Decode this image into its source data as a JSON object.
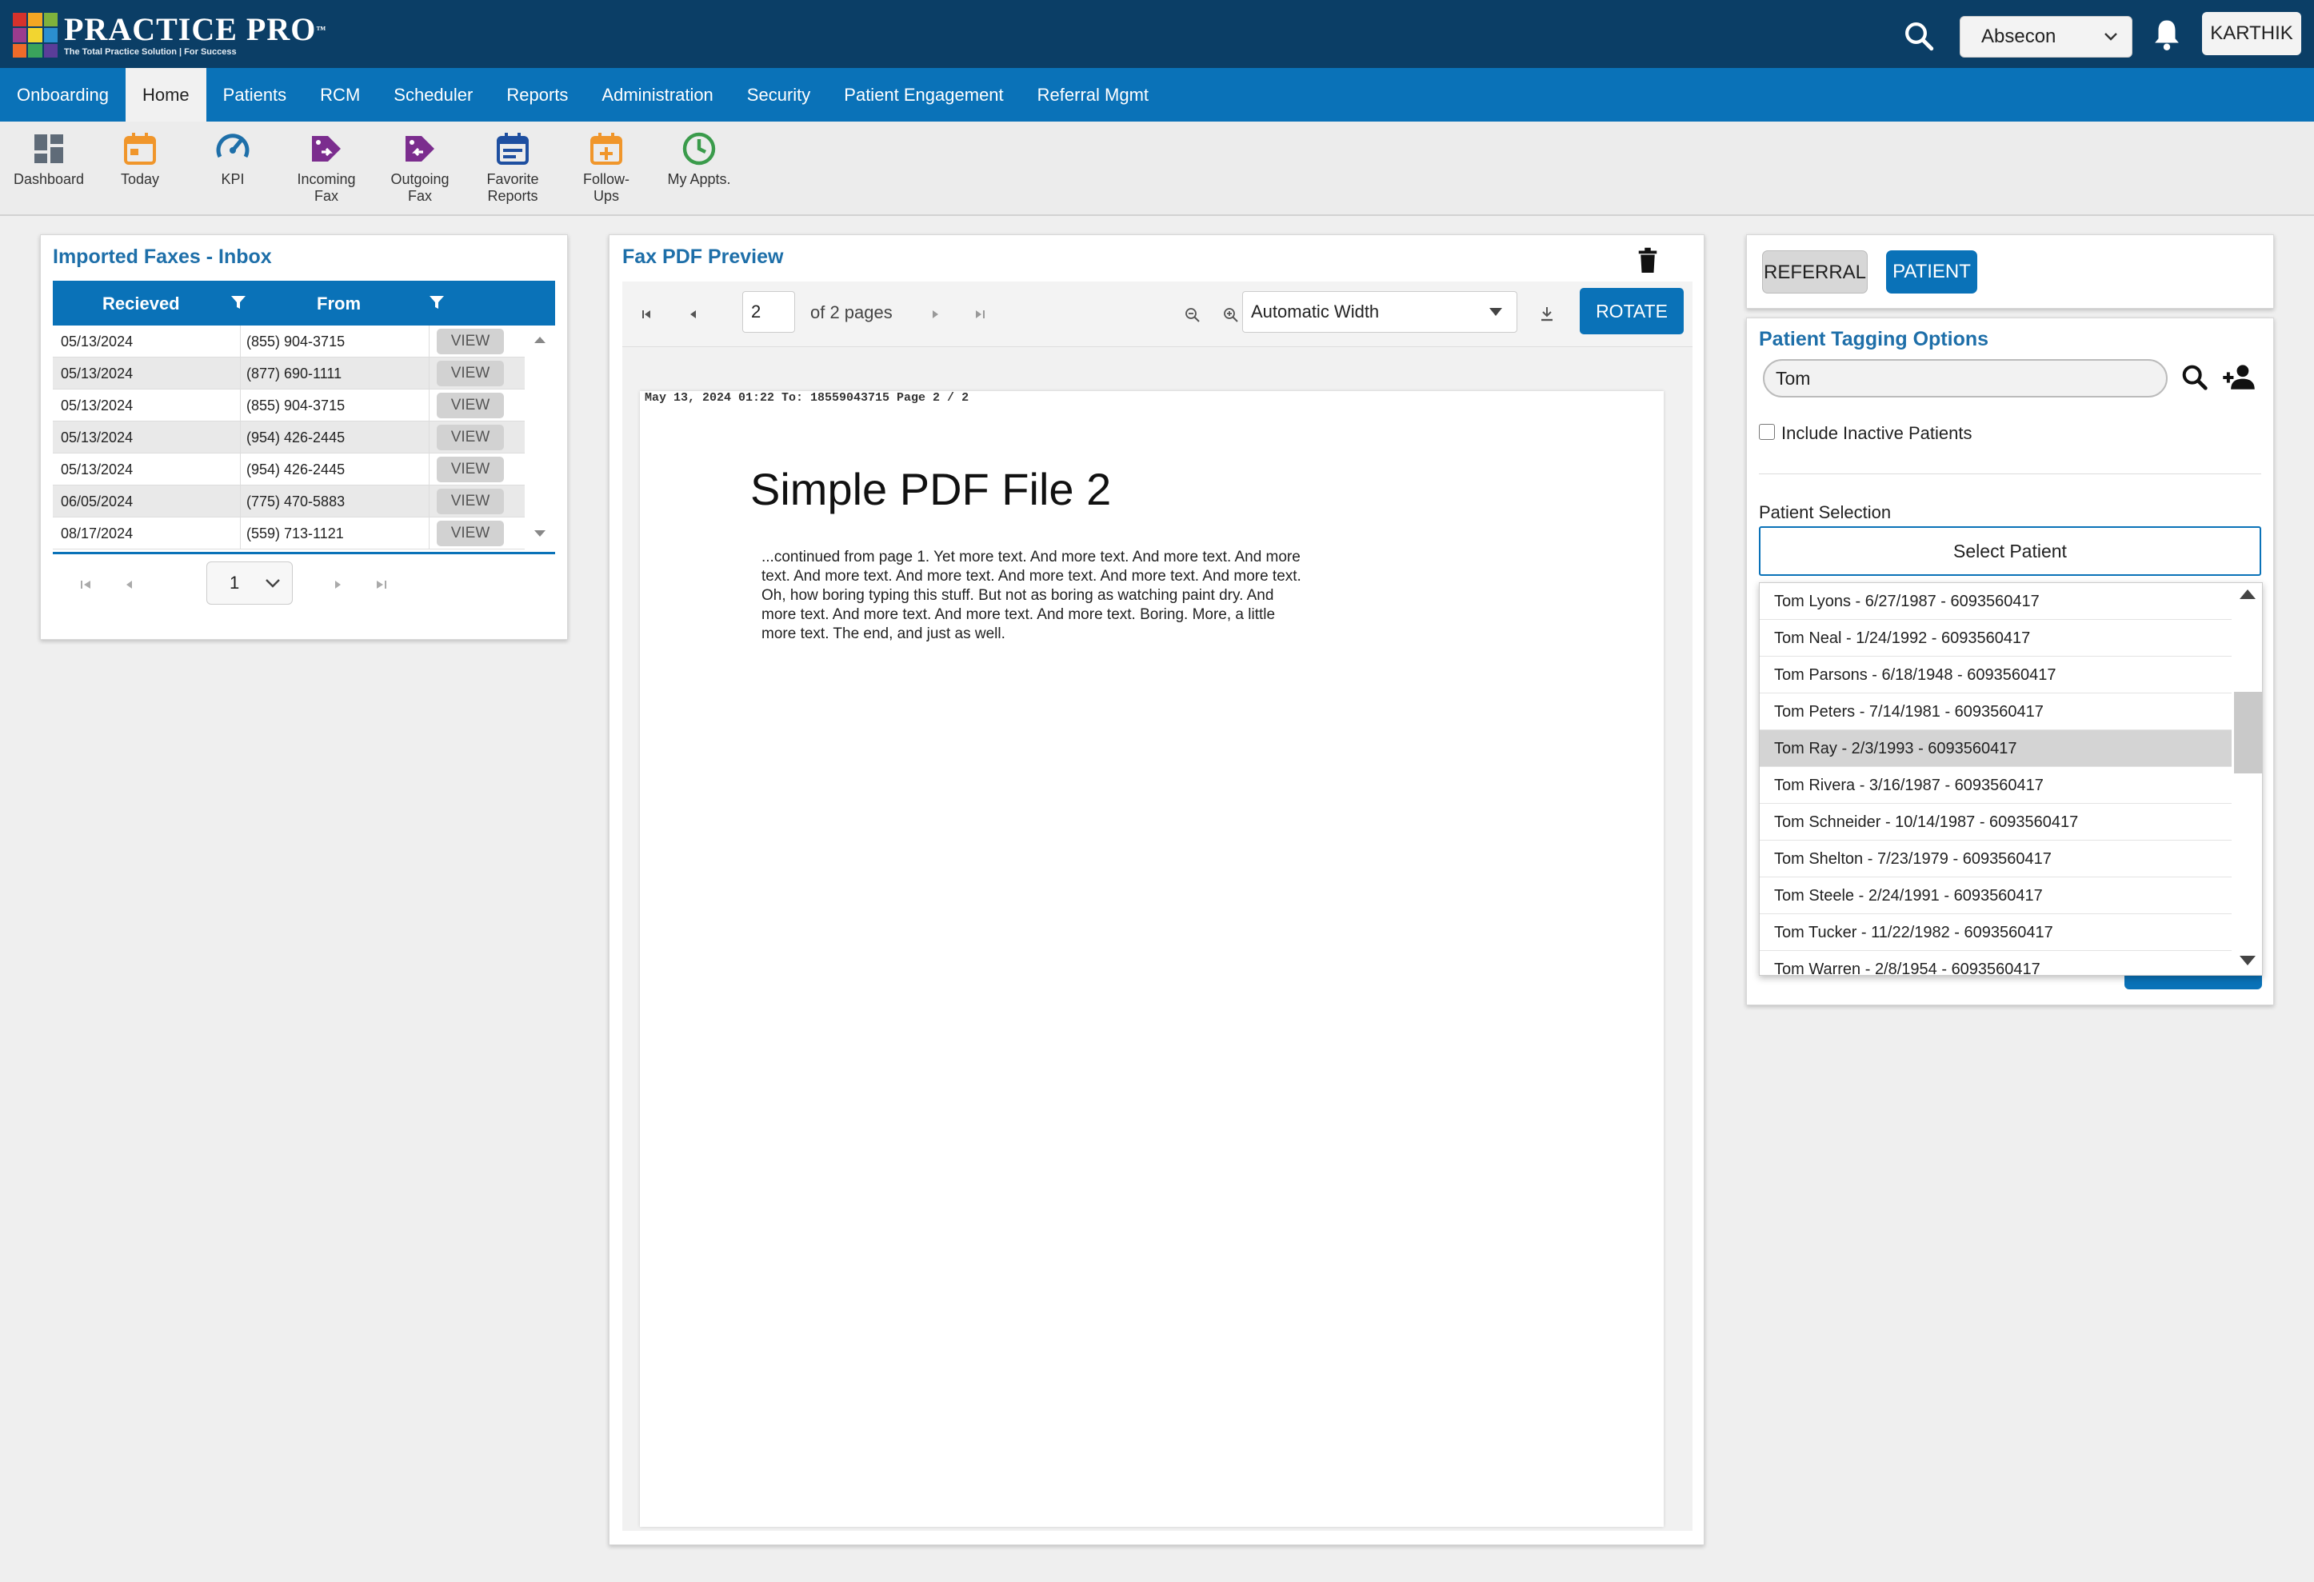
{
  "header": {
    "logo_name": "PRACTICE PRO",
    "logo_tm": "™",
    "logo_tagline": "The Total Practice Solution | For Success",
    "location": "Absecon",
    "user": "KARTHIK"
  },
  "nav": {
    "items": [
      {
        "label": "Onboarding"
      },
      {
        "label": "Home"
      },
      {
        "label": "Patients"
      },
      {
        "label": "RCM"
      },
      {
        "label": "Scheduler"
      },
      {
        "label": "Reports"
      },
      {
        "label": "Administration"
      },
      {
        "label": "Security"
      },
      {
        "label": "Patient Engagement"
      },
      {
        "label": "Referral Mgmt"
      }
    ],
    "active": "Home"
  },
  "toolbar": {
    "items": [
      {
        "line1": "Dashboard",
        "line2": "",
        "icon": "dashboard-icon"
      },
      {
        "line1": "Today",
        "line2": "",
        "icon": "calendar-today-icon"
      },
      {
        "line1": "KPI",
        "line2": "",
        "icon": "gauge-icon"
      },
      {
        "line1": "Incoming",
        "line2": "Fax",
        "icon": "incoming-fax-icon"
      },
      {
        "line1": "Outgoing",
        "line2": "Fax",
        "icon": "outgoing-fax-icon"
      },
      {
        "line1": "Favorite",
        "line2": "Reports",
        "icon": "favorite-reports-icon"
      },
      {
        "line1": "Follow-",
        "line2": "Ups",
        "icon": "follow-ups-icon"
      },
      {
        "line1": "My Appts.",
        "line2": "",
        "icon": "clock-icon"
      }
    ]
  },
  "inbox": {
    "title": "Imported Faxes - Inbox",
    "col_received": "Recieved",
    "col_from": "From",
    "view_label": "VIEW",
    "rows": [
      {
        "date": "05/13/2024",
        "from": "(855) 904-3715"
      },
      {
        "date": "05/13/2024",
        "from": "(877) 690-1111"
      },
      {
        "date": "05/13/2024",
        "from": "(855) 904-3715"
      },
      {
        "date": "05/13/2024",
        "from": "(954) 426-2445"
      },
      {
        "date": "05/13/2024",
        "from": "(954) 426-2445"
      },
      {
        "date": "06/05/2024",
        "from": "(775) 470-5883"
      },
      {
        "date": "08/17/2024",
        "from": "(559) 713-1121"
      }
    ],
    "page": "1"
  },
  "preview": {
    "title": "Fax PDF Preview",
    "page_input": "2",
    "of_pages": "of 2 pages",
    "zoom": "Automatic Width",
    "rotate_label": "ROTATE",
    "pdf_header": "May 13, 2024 01:22 To: 18559043715 Page 2 / 2",
    "pdf_title": "Simple PDF File 2",
    "pdf_body": "...continued from page 1. Yet more text. And more text. And more text. And more text. And more text. And more text. And more text. And more text. And more text. Oh, how boring typing this stuff. But not as boring as watching paint dry. And more text. And more text. And more text. And more text. Boring.  More, a little more text. The end, and just as well."
  },
  "toggle": {
    "referral": "REFERRAL",
    "patient": "PATIENT"
  },
  "tagging": {
    "title": "Patient Tagging Options",
    "search_value": "Tom",
    "include_inactive": "Include Inactive Patients",
    "selection_label": "Patient Selection",
    "select_placeholder": "Select Patient",
    "patients": [
      "Tom Lyons - 6/27/1987 - 6093560417",
      "Tom Neal - 1/24/1992 - 6093560417",
      "Tom Parsons - 6/18/1948 - 6093560417",
      "Tom Peters - 7/14/1981 - 6093560417",
      "Tom Ray - 2/3/1993 - 6093560417",
      "Tom Rivera - 3/16/1987 - 6093560417",
      "Tom Schneider - 10/14/1987 - 6093560417",
      "Tom Shelton - 7/23/1979 - 6093560417",
      "Tom Steele - 2/24/1991 - 6093560417",
      "Tom Tucker - 11/22/1982 - 6093560417",
      "Tom Warren - 2/8/1954 - 6093560417"
    ],
    "highlighted": "Tom Ray - 2/3/1993 - 6093560417"
  },
  "colors": {
    "topbar": "#0b3e66",
    "nav": "#0a72b8",
    "accent_title": "#1e6fa9",
    "purple_icon": "#7b2d8e",
    "orange_icon": "#f0962b",
    "green_icon": "#3a9b4b"
  }
}
